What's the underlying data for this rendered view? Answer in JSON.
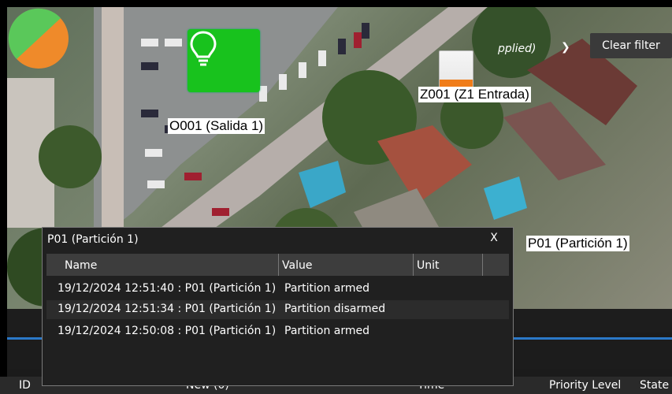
{
  "map": {
    "output_label": "O001 (Salida 1)",
    "zone_label": "Z001 (Z1 Entrada)",
    "partition_label": "P01 (Partición 1)",
    "output_icon": "lightbulb-icon",
    "zone_icon": "zone-sensor-icon",
    "partition_icon": "partition-pie-icon",
    "colors": {
      "output": "#18c21d",
      "zone_fill": "#f07d1a",
      "partition_green": "#5ac85a",
      "partition_orange": "#ef8a2a"
    }
  },
  "dialog": {
    "title": "P01 (Partición 1)",
    "close": "X",
    "columns": [
      "Name",
      "Value",
      "Unit"
    ],
    "rows": [
      {
        "name": "19/12/2024 12:51:40 : P01 (Partición 1)",
        "value": "Partition armed",
        "unit": ""
      },
      {
        "name": "19/12/2024 12:51:34 : P01 (Partición 1)",
        "value": "Partition disarmed",
        "unit": ""
      },
      {
        "name": "19/12/2024 12:50:08 : P01 (Partición 1)",
        "value": "Partition armed",
        "unit": ""
      }
    ]
  },
  "events": {
    "filter_applied": "pplied)",
    "clear_filter": "Clear filter",
    "columns": {
      "id": "ID",
      "new": "New (0)",
      "time": "Time",
      "priority": "Priority Level",
      "state": "State"
    }
  }
}
